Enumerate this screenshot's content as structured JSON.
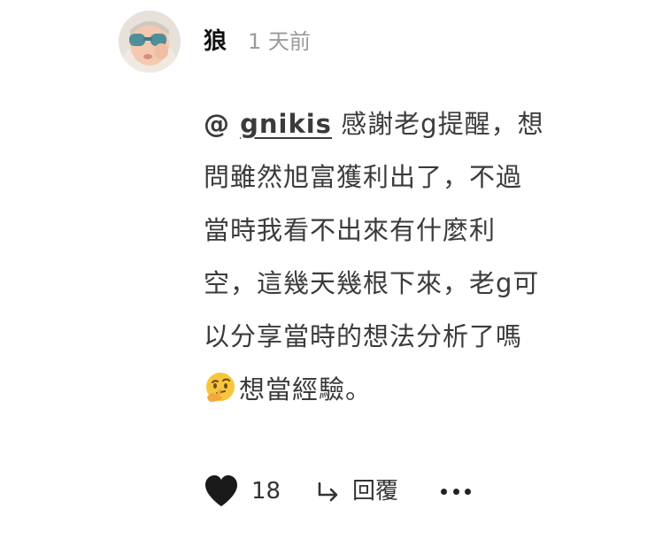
{
  "comment": {
    "author": "狼",
    "timestamp": "1 天前",
    "mention_prefix": "@ ",
    "mention_name": "gnikis",
    "lines": [
      " 感謝老g提醒，想",
      "問雖然旭富獲利出了，不過",
      "當時我看不出來有什麼利",
      "空，這幾天幾根下來，老g可",
      "以分享當時的想法分析了嗎",
      "想當經驗。"
    ],
    "emoji": "thinking-face-emoji"
  },
  "actions": {
    "like_icon": "heart-icon",
    "like_count": "18",
    "reply_icon": "reply-arrow-icon",
    "reply_label": "回覆",
    "more_icon": "more-dots-icon"
  }
}
